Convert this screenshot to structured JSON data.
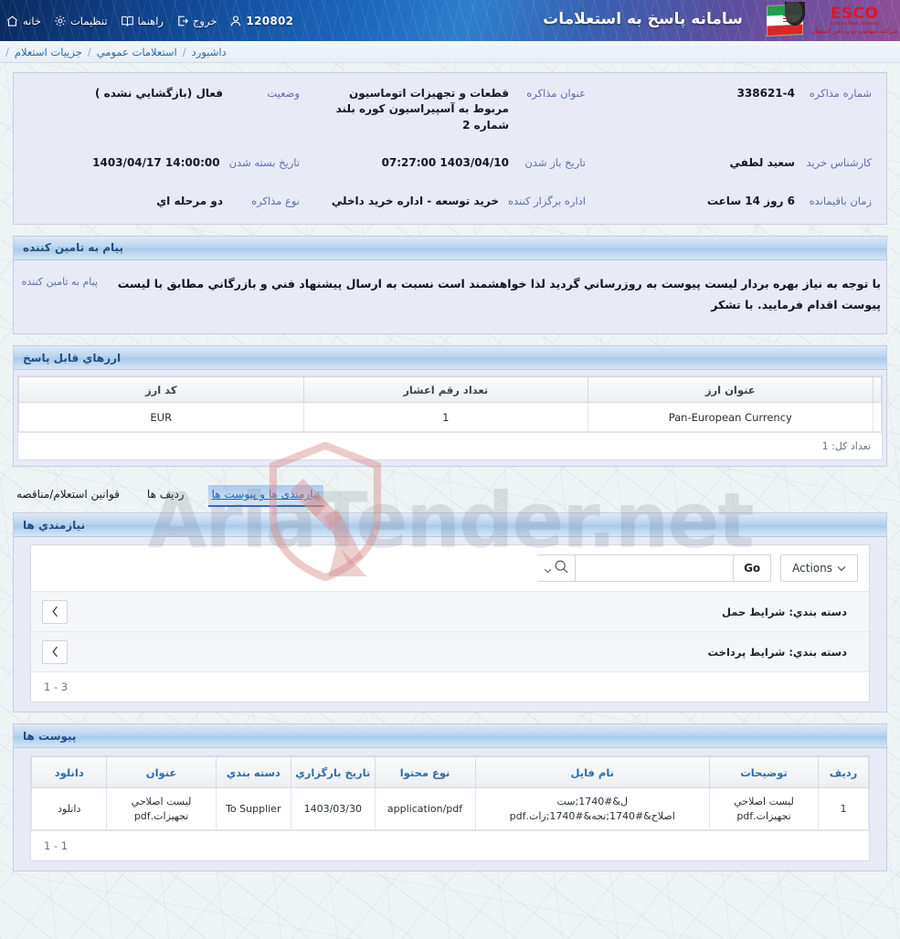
{
  "header": {
    "app_title": "سامانه پاسخ به استعلامات",
    "logo_main": "ESCO",
    "logo_sub": "Esfahan Steel Company",
    "logo_fa": "شرکت سهامی ذوب آهن اصفهان",
    "nav": [
      {
        "label": "خانه",
        "icon": "home-icon"
      },
      {
        "label": "تنظیمات",
        "icon": "gear-icon"
      },
      {
        "label": "راهنما",
        "icon": "book-icon"
      },
      {
        "label": "خروج",
        "icon": "logout-icon"
      },
      {
        "label": "120802",
        "icon": "user-icon"
      }
    ]
  },
  "breadcrumb": {
    "items": [
      "داشبورد",
      "استعلامات عمومي",
      "جزییات استعلام"
    ],
    "separator": "/"
  },
  "details": {
    "fields": [
      {
        "label": "شماره مذاکره",
        "value": "338621-4"
      },
      {
        "label": "عنوان مذاکره",
        "value": "قطعات و تجهیزات اتوماسیون مربوط به آسپیراسیون کوره بلند شماره 2"
      },
      {
        "label": "وضعیت",
        "value": "فعال (بازگشایي نشده )"
      },
      {
        "label": "کارشناس خرید",
        "value": "سعید لطفي"
      },
      {
        "label": "تاریخ باز شدن",
        "value": "07:27:00 1403/04/10"
      },
      {
        "label": "تاریخ بسته شدن",
        "value": "1403/04/17 14:00:00"
      },
      {
        "label": "زمان باقیمانده",
        "value": "6 روز 14 ساعت"
      },
      {
        "label": "اداره برگزار کننده",
        "value": "خرید توسعه - اداره خرید داخلي"
      },
      {
        "label": "نوع مذاکره",
        "value": "دو مرحله اي"
      }
    ]
  },
  "message_panel": {
    "title": "پیام به تامین کننده",
    "label": "پیام به تامین کننده",
    "text": "با توجه به نیاز بهره بردار لیست پیوست به روزرساني گردید لذا خواهشمند است نسبت به ارسال پیشنهاد فني و بازرگاني مطابق با لیست پیوست اقدام فرمایید. با تشکر"
  },
  "currency_panel": {
    "title": "ارزهاي قابل پاسخ",
    "columns": [
      "کد ارز",
      "تعداد رقم اعشار",
      "عنوان ارز"
    ],
    "rows": [
      {
        "code": "EUR",
        "decimals": "1",
        "name": "Pan-European Currency"
      }
    ],
    "footer": "تعداد کل: 1"
  },
  "tabs": [
    {
      "label": "نیازمندی ها و پیوست ها",
      "active": true
    },
    {
      "label": "ردیف ها",
      "active": false
    },
    {
      "label": "قوانین استعلام/مناقصه",
      "active": false
    }
  ],
  "requirements_panel": {
    "title": "نیازمندي ها",
    "search_placeholder": "",
    "search_value": "",
    "go_label": "Go",
    "actions_label": "Actions",
    "groups": [
      {
        "label": "دسته بندي: شرایط حمل"
      },
      {
        "label": "دسته بندي: شرایط پرداخت"
      }
    ],
    "footer": "1 - 3"
  },
  "attachments_panel": {
    "title": "پیوست ها",
    "columns": [
      "ردیف",
      "توضیحات",
      "نام فایل",
      "نوع محتوا",
      "تاریخ بارگزاري",
      "دسته بندي",
      "عنوان",
      "دانلود"
    ],
    "rows": [
      {
        "index": "1",
        "description": "لیست اصلاحي تجهیزات.pdf",
        "filename": "ل&#1740;ست اصلاح&#1740;تجه&#1740;زات.pdf",
        "content_type": "application/pdf",
        "upload_date": "1403/03/30",
        "category": "To Supplier",
        "title": "لیست اصلاحي تجهیزات.pdf",
        "download": "دانلود"
      }
    ],
    "footer": "1 - 1"
  },
  "watermark": {
    "text": "AriaTender.net"
  },
  "colors": {
    "accent": "#2d6cb0",
    "panel_bg": "#e8eaf6",
    "label": "#5e6fa6",
    "brand_red": "#d7182a"
  }
}
